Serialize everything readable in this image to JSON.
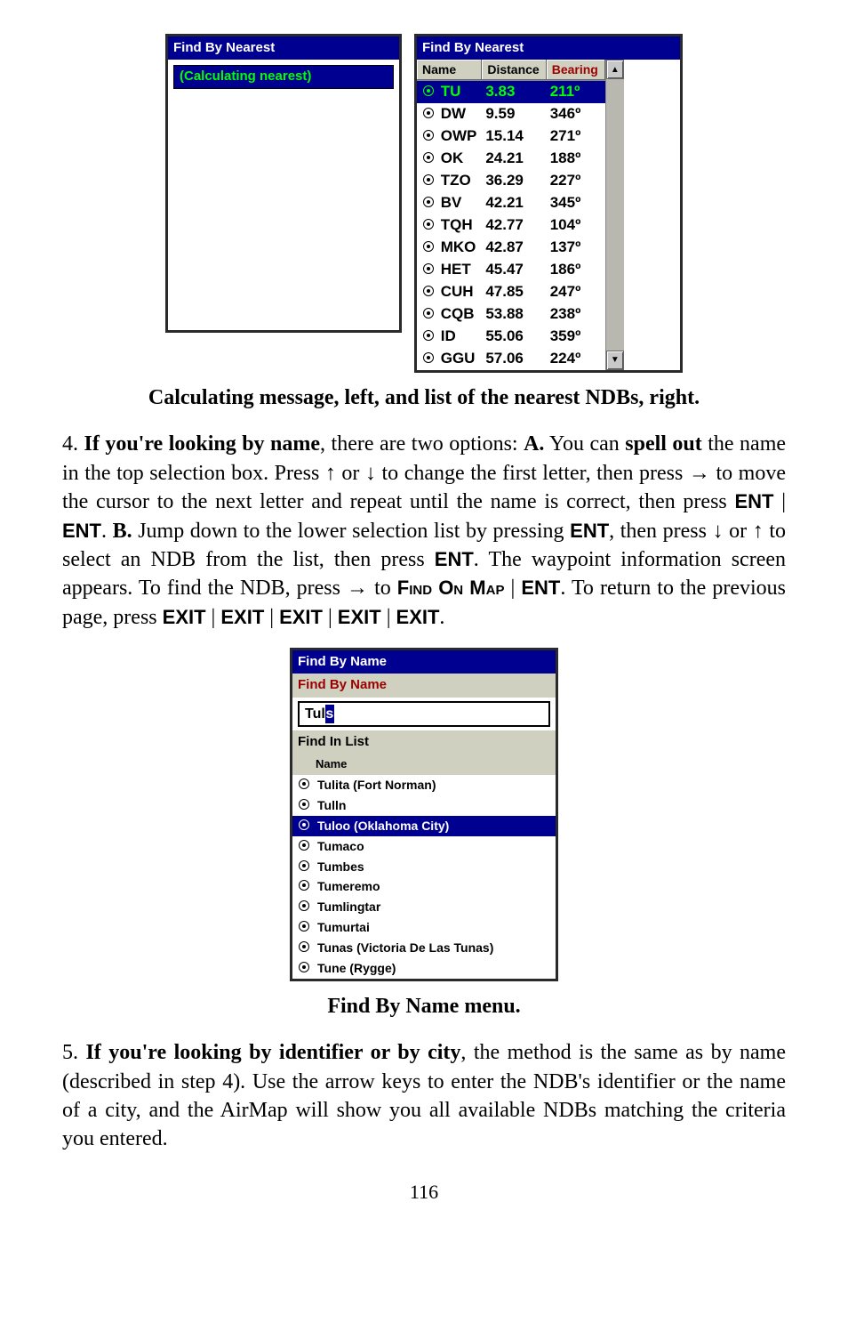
{
  "fig1": {
    "left": {
      "title": "Find By Nearest",
      "msg": "(Calculating nearest)"
    },
    "right": {
      "title": "Find By Nearest",
      "cols": {
        "name": "Name",
        "distance": "Distance",
        "bearing": "Bearing"
      },
      "rows": [
        {
          "name": "TU",
          "distance": "3.83",
          "bearing": "211º",
          "hi": true
        },
        {
          "name": "DW",
          "distance": "9.59",
          "bearing": "346º"
        },
        {
          "name": "OWP",
          "distance": "15.14",
          "bearing": "271º"
        },
        {
          "name": "OK",
          "distance": "24.21",
          "bearing": "188º"
        },
        {
          "name": "TZO",
          "distance": "36.29",
          "bearing": "227º"
        },
        {
          "name": "BV",
          "distance": "42.21",
          "bearing": "345º"
        },
        {
          "name": "TQH",
          "distance": "42.77",
          "bearing": "104º"
        },
        {
          "name": "MKO",
          "distance": "42.87",
          "bearing": "137º"
        },
        {
          "name": "HET",
          "distance": "45.47",
          "bearing": "186º"
        },
        {
          "name": "CUH",
          "distance": "47.85",
          "bearing": "247º"
        },
        {
          "name": "CQB",
          "distance": "53.88",
          "bearing": "238º"
        },
        {
          "name": "ID",
          "distance": "55.06",
          "bearing": "359º"
        },
        {
          "name": "GGU",
          "distance": "57.06",
          "bearing": "224º"
        }
      ]
    }
  },
  "caption1": "Calculating message, left, and list of the nearest NDBs, right.",
  "step4": {
    "num": "4.",
    "head": "If you're looking by name",
    "tA": ", there are two options: ",
    "labelA": "A.",
    "a1": " You can ",
    "spell": "spell out",
    "a2": " the name in the top selection box. Press ",
    "arrowUp": "↑",
    "or": " or ",
    "arrowDn": "↓",
    "a3": " to change the first letter, then press ",
    "arrowRt": "→",
    "a4": " to move the cursor to the next letter and repeat until the name is correct, then press ",
    "ent": "ENT",
    "pipe": " | ",
    "labelB": "B.",
    "b1": " Jump down to the lower selection list by pressing ",
    "b2": ", then press ",
    "b3": " to select an NDB from the list, then press ",
    "b4": ". The waypoint information screen appears. To find the NDB, press ",
    "findmap": "Find On Map",
    "b5": ". To return to the previous page, press ",
    "exit": "EXIT",
    "period": "."
  },
  "fig2": {
    "title1": "Find By Name",
    "title2": "Find By Name",
    "input_prefix": "Tul",
    "input_cursor": "s",
    "findIn": "Find In List",
    "colName": "Name",
    "items": [
      {
        "label": "Tulita (Fort Norman)"
      },
      {
        "label": "Tulln"
      },
      {
        "label": "Tuloo (Oklahoma City)",
        "hi": true
      },
      {
        "label": "Tumaco"
      },
      {
        "label": "Tumbes"
      },
      {
        "label": "Tumeremo"
      },
      {
        "label": "Tumlingtar"
      },
      {
        "label": "Tumurtai"
      },
      {
        "label": "Tunas (Victoria De Las Tunas)"
      },
      {
        "label": "Tune (Rygge)"
      }
    ]
  },
  "caption2": "Find By Name menu.",
  "step5": {
    "num": "5.",
    "head": "If you're looking by identifier or by city",
    "body": ", the method is the same as by name (described in step 4). Use the arrow keys to enter the NDB's identifier or the name of a city, and the AirMap will show you all available NDBs matching the criteria you entered."
  },
  "pageno": "116"
}
